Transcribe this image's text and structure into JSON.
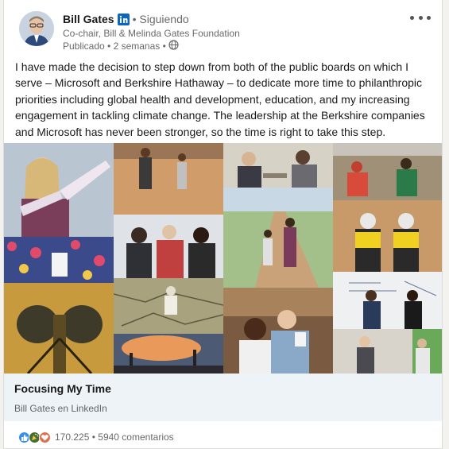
{
  "post": {
    "author": {
      "name": "Bill Gates",
      "follow_status": "• Siguiendo",
      "headline": "Co-chair, Bill & Melinda Gates Foundation",
      "published": "Publicado • 2 semanas •"
    },
    "text": "I have made the decision to step down from both of the public boards on which I serve – Microsoft and Berkshire Hathaway – to dedicate more time to philanthropic priorities including global health and development, education, and my increasing engagement in tackling climate change. The leadership at the Berkshire companies and Microsoft has never been stronger, so the time is right to take this step.",
    "article": {
      "title": "Focusing My Time",
      "source": "Bill Gates en LinkedIn"
    },
    "social": {
      "reactions_count": "170.225",
      "separator": "•",
      "comments": "5940 comentarios"
    }
  },
  "icons": {
    "linkedin_badge": "linkedin-icon",
    "visibility": "globe-icon",
    "menu": "more-options-icon",
    "reactions": [
      "like-reaction-icon",
      "celebrate-reaction-icon",
      "love-reaction-icon"
    ]
  },
  "colors": {
    "linkedin_blue": "#0a66c2",
    "link_bar_bg": "#eef3f8",
    "like": "#378fe9",
    "celebrate": "#44712e",
    "love": "#df704d"
  }
}
